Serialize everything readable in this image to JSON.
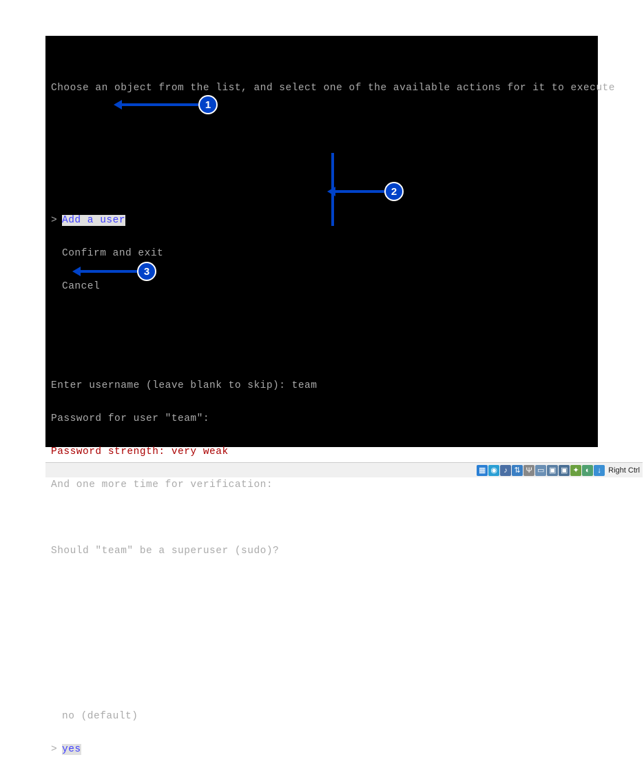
{
  "header": "Choose an object from the list, and select one of the available actions for it to execute",
  "menu1": {
    "selected": "Add a user",
    "item2": "Confirm and exit",
    "item3": "Cancel"
  },
  "dialog": {
    "l1": "Enter username (leave blank to skip): team",
    "l2": "Password for user \"team\":",
    "l3": "Password strength: very weak",
    "l4": "And one more time for verification:",
    "l5": "",
    "l6": "Should \"team\" be a superuser (sudo)?"
  },
  "menu2": {
    "item1": "no (default)",
    "selected": "yes"
  },
  "callouts": {
    "c1": "1",
    "c2": "2",
    "c3": "3"
  },
  "statusbar": {
    "host_key": "Right Ctrl"
  },
  "icons": {
    "hard_disk": "hard-disk-icon",
    "optical": "optical-disk-icon",
    "audio": "audio-icon",
    "network": "network-icon",
    "usb": "usb-icon",
    "shared": "shared-folder-icon",
    "display": "display-icon",
    "recording": "recording-icon",
    "cpu": "cpu-icon",
    "mouse": "mouse-icon",
    "keyboard": "keyboard-icon"
  }
}
